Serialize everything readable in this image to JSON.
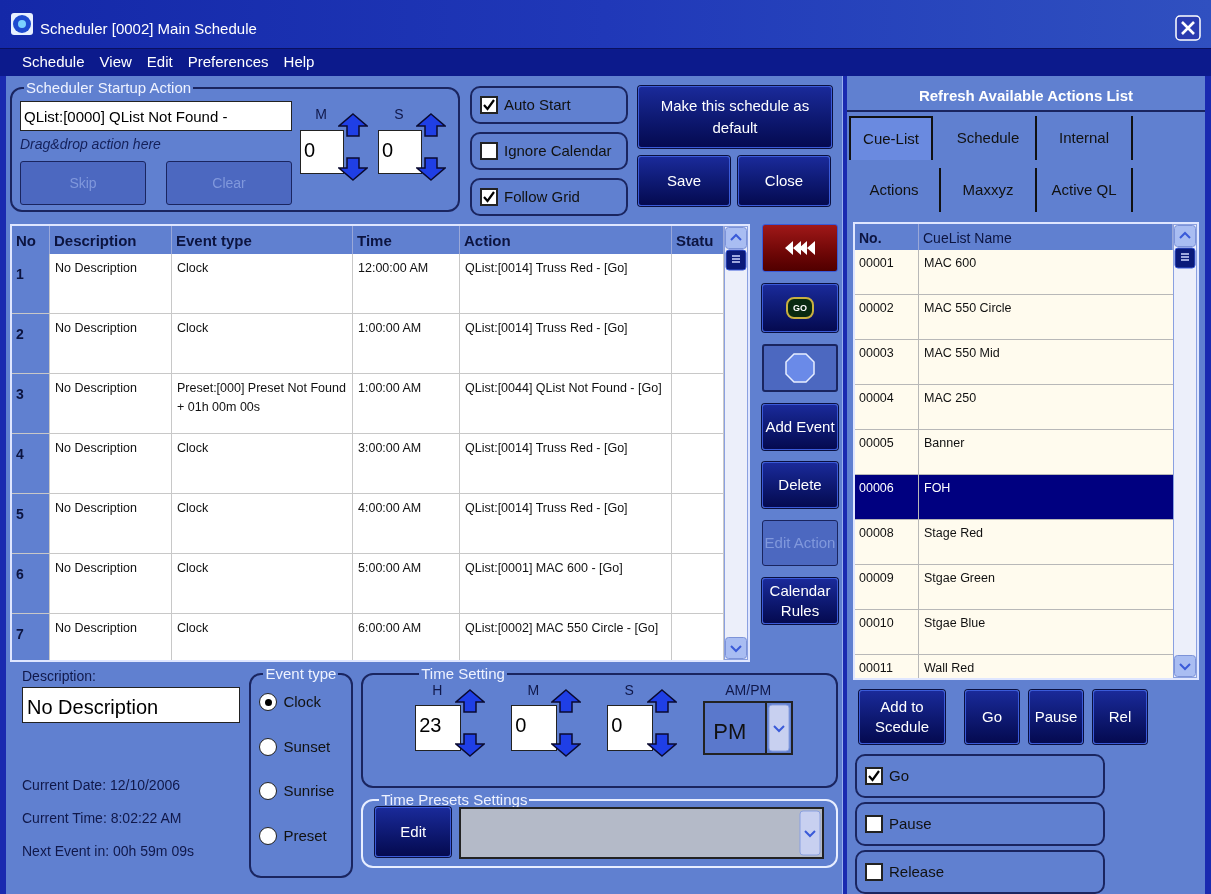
{
  "window": {
    "title": "Scheduler [0002] Main Schedule"
  },
  "menu": [
    "Schedule",
    "View",
    "Edit",
    "Preferences",
    "Help"
  ],
  "startup_action": {
    "title": "Scheduler Startup Action",
    "value": "QList:[0000] QList Not Found -",
    "hint": "Drag&drop action here",
    "buttons": [
      {
        "label": "Skip",
        "disabled": true
      },
      {
        "label": "Clear",
        "disabled": true
      }
    ],
    "spinners": [
      {
        "label": "M",
        "value": "0"
      },
      {
        "label": "S",
        "value": "0"
      }
    ]
  },
  "options": [
    {
      "label": "Auto Start",
      "checked": true
    },
    {
      "label": "Ignore Calendar",
      "checked": false
    },
    {
      "label": "Follow Grid",
      "checked": true
    }
  ],
  "top_buttons": [
    {
      "label": "Make this schedule as default"
    },
    {
      "label": "Save"
    },
    {
      "label": "Close"
    }
  ],
  "events_table": {
    "columns": [
      "No",
      "Description",
      "Event type",
      "Time",
      "Action",
      "Statu"
    ],
    "rows": [
      {
        "cells": [
          "1",
          "No Description",
          "Clock",
          "12:00:00 AM",
          "QList:[0014] Truss Red - [Go]",
          ""
        ]
      },
      {
        "cells": [
          "2",
          "No Description",
          "Clock",
          "1:00:00 AM",
          "QList:[0014] Truss Red - [Go]",
          ""
        ]
      },
      {
        "cells": [
          "3",
          "No Description",
          "Preset:[000] Preset Not Found + 01h 00m 00s",
          "1:00:00 AM",
          "QList:[0044] QList Not Found - [Go]",
          ""
        ]
      },
      {
        "cells": [
          "4",
          "No Description",
          "Clock",
          "3:00:00 AM",
          "QList:[0014] Truss Red - [Go]",
          ""
        ]
      },
      {
        "cells": [
          "5",
          "No Description",
          "Clock",
          "4:00:00 AM",
          "QList:[0014] Truss Red - [Go]",
          ""
        ]
      },
      {
        "cells": [
          "6",
          "No Description",
          "Clock",
          "5:00:00 AM",
          "QList:[0001] MAC 600 - [Go]",
          ""
        ]
      },
      {
        "cells": [
          "7",
          "No Description",
          "Clock",
          "6:00:00 AM",
          "QList:[0002] MAC 550 Circle - [Go]",
          ""
        ]
      }
    ]
  },
  "side_buttons": [
    {
      "kind": "rewind"
    },
    {
      "kind": "go",
      "label": "GO"
    },
    {
      "kind": "stop"
    },
    {
      "kind": "text",
      "label": "Add Event",
      "disabled": false
    },
    {
      "kind": "text",
      "label": "Delete",
      "disabled": false
    },
    {
      "kind": "text",
      "label": "Edit Action",
      "disabled": true
    },
    {
      "kind": "text",
      "label": "Calendar Rules",
      "disabled": false
    }
  ],
  "description": {
    "label": "Description:",
    "value": "No Description"
  },
  "status": [
    "Current Date: 12/10/2006",
    "Current Time: 8:02:22 AM",
    "Next Event in: 00h 59m 09s"
  ],
  "event_type": {
    "title": "Event type",
    "options": [
      {
        "label": "Clock",
        "selected": true
      },
      {
        "label": "Sunset",
        "selected": false
      },
      {
        "label": "Sunrise",
        "selected": false
      },
      {
        "label": "Preset",
        "selected": false
      }
    ]
  },
  "time_settings": {
    "title": "Time Setting",
    "spinners": [
      {
        "label": "H",
        "value": "23"
      },
      {
        "label": "M",
        "value": "0"
      },
      {
        "label": "S",
        "value": "0"
      }
    ],
    "ampm": {
      "label": "AM/PM",
      "value": "PM"
    }
  },
  "time_presets": {
    "title": "Time Presets Settings",
    "button": "Edit"
  },
  "actions_panel": {
    "refresh": "Refresh Available Actions List",
    "tabs": [
      {
        "label": "Cue-List",
        "selected": true
      },
      {
        "label": "Schedule",
        "selected": false
      },
      {
        "label": "Internal",
        "selected": false
      },
      {
        "label": "Actions",
        "selected": false
      },
      {
        "label": "Maxxyz",
        "selected": false
      },
      {
        "label": "Active QL",
        "selected": false
      }
    ],
    "columns": [
      "No.",
      "CueList Name"
    ],
    "rows": [
      {
        "no": "00001",
        "name": "MAC 600",
        "selected": false
      },
      {
        "no": "00002",
        "name": "MAC 550 Circle",
        "selected": false
      },
      {
        "no": "00003",
        "name": "MAC 550 Mid",
        "selected": false
      },
      {
        "no": "00004",
        "name": "MAC 250",
        "selected": false
      },
      {
        "no": "00005",
        "name": "Banner",
        "selected": false
      },
      {
        "no": "00006",
        "name": "FOH",
        "selected": true
      },
      {
        "no": "00008",
        "name": "Stage Red",
        "selected": false
      },
      {
        "no": "00009",
        "name": "Stgae Green",
        "selected": false
      },
      {
        "no": "00010",
        "name": "Stgae Blue",
        "selected": false
      },
      {
        "no": "00011",
        "name": "Wall Red",
        "selected": false
      }
    ],
    "buttons": [
      {
        "label": "Add to Scedule"
      },
      {
        "label": "Go"
      },
      {
        "label": "Pause"
      },
      {
        "label": "Rel"
      }
    ],
    "options": [
      {
        "label": "Go",
        "checked": true
      },
      {
        "label": "Pause",
        "checked": false
      },
      {
        "label": "Release",
        "checked": false
      }
    ]
  }
}
